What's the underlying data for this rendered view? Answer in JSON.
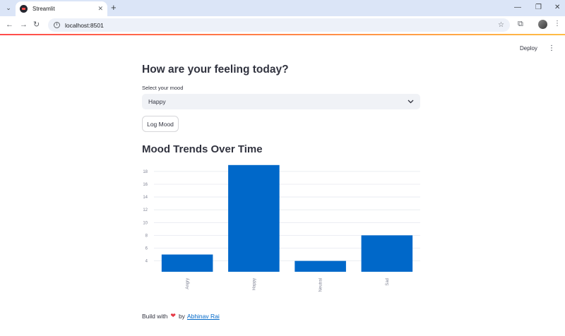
{
  "browser": {
    "tab_title": "Streamlit",
    "url": "localhost:8501"
  },
  "app": {
    "deploy_label": "Deploy",
    "title": "How are your feeling today?",
    "select": {
      "label": "Select your mood",
      "value": "Happy"
    },
    "log_button": "Log Mood",
    "chart_title": "Mood Trends Over Time",
    "footer": {
      "prefix": "Build with",
      "by": "by",
      "author": "Abhinav Rai"
    }
  },
  "colors": {
    "bar": "#0068c9",
    "accent": "#ff4b4b",
    "link": "#0068c9"
  },
  "chart_data": {
    "type": "bar",
    "categories": [
      "Angry",
      "Happy",
      "Neutral",
      "Sad"
    ],
    "values": [
      5,
      19,
      4,
      8
    ],
    "y_ticks": [
      4,
      6,
      8,
      10,
      12,
      14,
      16,
      18
    ],
    "ylim": [
      2.3,
      19.2
    ],
    "grid": true,
    "legend": "none",
    "title": "",
    "xlabel": "",
    "ylabel": ""
  }
}
